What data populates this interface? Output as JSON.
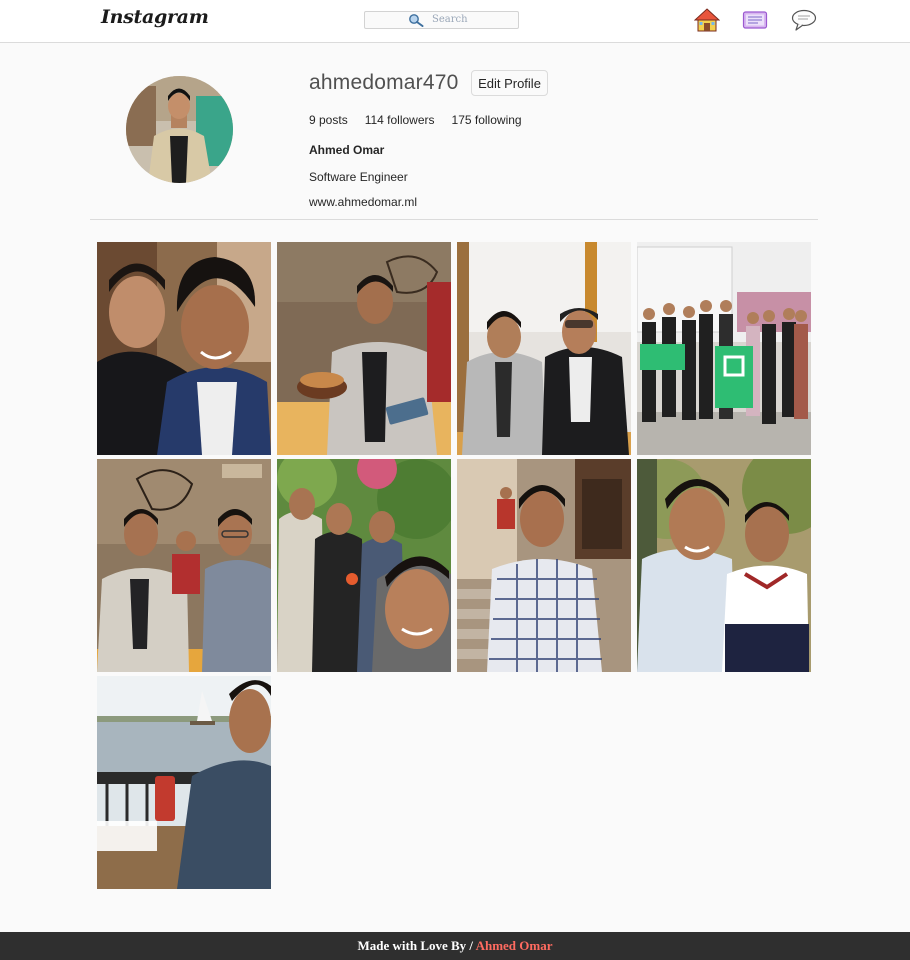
{
  "nav": {
    "logo": "Instagram",
    "search_placeholder": "Search",
    "icons": [
      "home-icon",
      "activity-icon",
      "messages-icon"
    ]
  },
  "profile": {
    "username": "ahmedomar470",
    "edit_button": "Edit Profile",
    "stats": {
      "posts": "9 posts",
      "followers": "114 followers",
      "following": "175 following"
    },
    "full_name": "Ahmed Omar",
    "bio": "Software Engineer",
    "website": "www.ahmedomar.ml"
  },
  "posts": [
    {
      "scene": "selfie-two-friends"
    },
    {
      "scene": "birthday-cake-cafe"
    },
    {
      "scene": "two-friends-table"
    },
    {
      "scene": "developer-student-clubs-group"
    },
    {
      "scene": "cafe-friends"
    },
    {
      "scene": "garden-group-selfie"
    },
    {
      "scene": "building-stairs-portrait"
    },
    {
      "scene": "outdoor-two-friends"
    },
    {
      "scene": "nile-boat-selfie"
    }
  ],
  "footer": {
    "prefix": "Made with Love By / ",
    "author": "Ahmed Omar"
  },
  "colors": {
    "footer_bg": "#2f2f2f",
    "footer_author": "#ff6b60",
    "page_bg": "#fafafa"
  }
}
